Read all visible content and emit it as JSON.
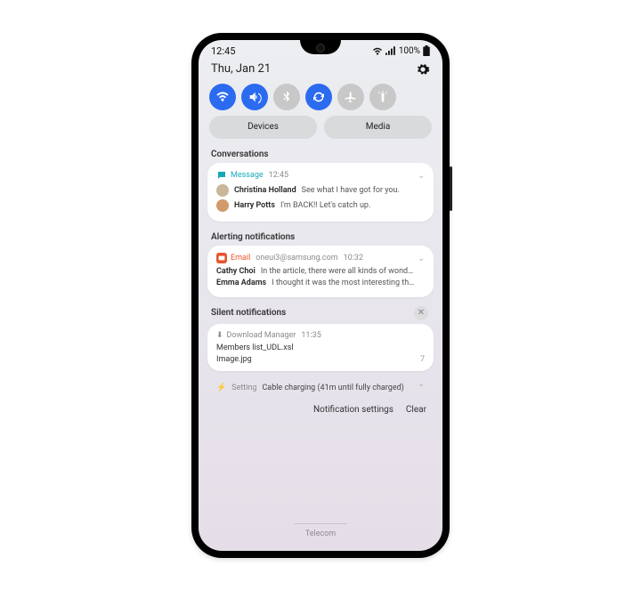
{
  "status": {
    "time": "12:45",
    "battery": "100%"
  },
  "header": {
    "date": "Thu, Jan 21"
  },
  "pills": {
    "devices": "Devices",
    "media": "Media"
  },
  "sections": {
    "conversations": "Conversations",
    "alerting": "Alerting notifications",
    "silent": "Silent notifications"
  },
  "conv": {
    "app": "Message",
    "time": "12:45",
    "items": [
      {
        "sender": "Christina Holland",
        "body": "See what I have got for you."
      },
      {
        "sender": "Harry Potts",
        "body": "I'm BACK!! Let's catch up."
      }
    ]
  },
  "alert": {
    "app": "Email",
    "account": "oneui3@samsung.com",
    "time": "10:32",
    "items": [
      {
        "sender": "Cathy Choi",
        "body": "In the article, there were all kinds of wond…"
      },
      {
        "sender": "Emma Adams",
        "body": "I thought it was the most interesting th…"
      }
    ]
  },
  "download": {
    "app": "Download Manager",
    "time": "11:35",
    "file1": "Members list_UDL.xsl",
    "file2": "Image.jpg",
    "count": "7"
  },
  "setting": {
    "app": "Setting",
    "body": "Cable charging (41m until fully charged)"
  },
  "footer": {
    "settings": "Notification settings",
    "clear": "Clear"
  },
  "telecom": "Telecom"
}
